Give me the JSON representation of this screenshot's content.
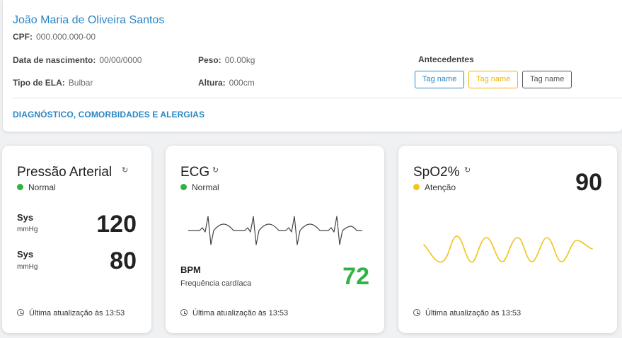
{
  "patient": {
    "name": "João Maria de Oliveira Santos",
    "cpf_label": "CPF:",
    "cpf_value": "000.000.000-00",
    "birth_label": "Data de nascimento:",
    "birth_value": "00/00/0000",
    "weight_label": "Peso:",
    "weight_value": "00.00kg",
    "ela_label": "Tipo de ELA:",
    "ela_value": "Bulbar",
    "height_label": "Altura:",
    "height_value": "000cm",
    "antecedentes_label": "Antecedentes",
    "tags": [
      {
        "label": "Tag name",
        "color": "#2b86c5"
      },
      {
        "label": "Tag name",
        "color": "#f0b400"
      },
      {
        "label": "Tag name",
        "color": "#555555"
      }
    ],
    "section_title": "DIAGNÓSTICO, COMORBIDADES E ALERGIAS"
  },
  "cards": {
    "pressure": {
      "title": "Pressão Arterial",
      "refresh_icon": "↻",
      "status": "Normal",
      "status_color": "#2fb344",
      "sys_label": "Sys",
      "sys_unit": "mmHg",
      "sys_value": "120",
      "dia_label": "Sys",
      "dia_unit": "mmHg",
      "dia_value": "80",
      "footer": "Última atualização às 13:53"
    },
    "ecg": {
      "title": "ECG",
      "refresh_icon": "↻",
      "status": "Normal",
      "status_color": "#2fb344",
      "bpm_label": "BPM",
      "bpm_sub": "Frequência cardíaca",
      "bpm_value": "72",
      "bpm_color": "#2fb344",
      "footer": "Última atualização às 13:53"
    },
    "spo2": {
      "title": "SpO2%",
      "refresh_icon": "↻",
      "status": "Atenção",
      "status_color": "#f5c518",
      "value": "90",
      "wave_color": "#f0c419",
      "footer": "Última atualização às 13:53"
    }
  }
}
